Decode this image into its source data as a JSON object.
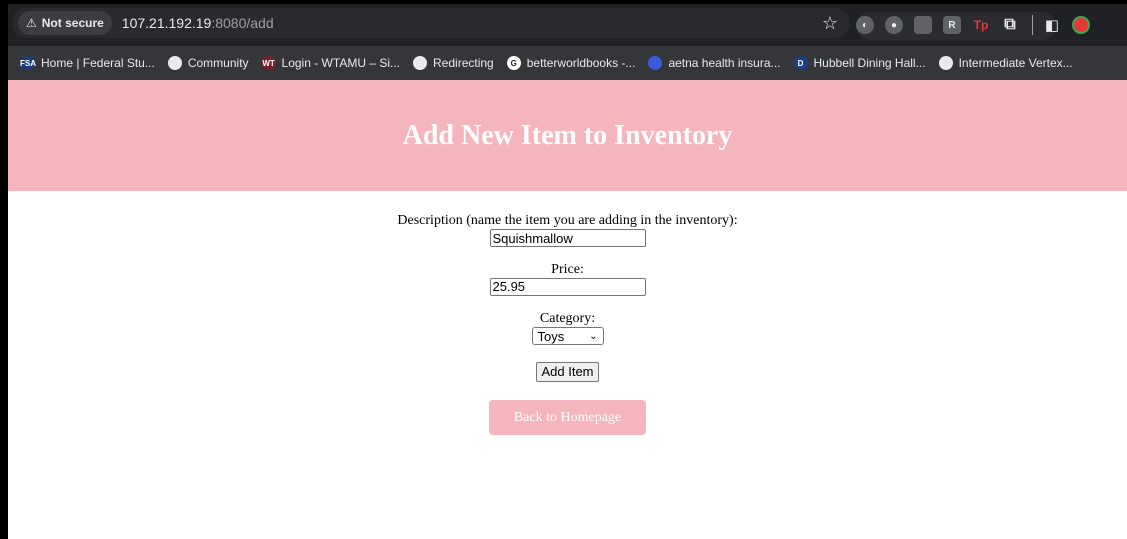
{
  "browser": {
    "security_label": "Not secure",
    "url_host": "107.21.192.19",
    "url_rest": ":8080/add",
    "bookmarks": [
      {
        "label": "Home | Federal Stu...",
        "icon": "fsa-icon",
        "badge": "FSA",
        "color": "#1a3d7c"
      },
      {
        "label": "Community",
        "icon": "globe-icon",
        "badge": "",
        "color": "#e8eaed"
      },
      {
        "label": "Login - WTAMU – Si...",
        "icon": "wt-icon",
        "badge": "WT",
        "color": "#7a1f2b"
      },
      {
        "label": "Redirecting",
        "icon": "globe-icon",
        "badge": "",
        "color": "#e8eaed"
      },
      {
        "label": "betterworldbooks -...",
        "icon": "google-icon",
        "badge": "G",
        "color": "#ffffff"
      },
      {
        "label": "aetna health insura...",
        "icon": "aetna-icon",
        "badge": "",
        "color": "#3b5bdb"
      },
      {
        "label": "Hubbell Dining Hall...",
        "icon": "d-logo-icon",
        "badge": "D",
        "color": "#1f3c88"
      },
      {
        "label": "Intermediate Vertex...",
        "icon": "globe-icon",
        "badge": "",
        "color": "#e8eaed"
      }
    ]
  },
  "page": {
    "title": "Add New Item to Inventory",
    "description_label": "Description (name the item you are adding in the inventory):",
    "description_value": "Squishmallow",
    "price_label": "Price:",
    "price_value": "25.95",
    "category_label": "Category:",
    "category_selected": "Toys",
    "submit_label": "Add Item",
    "back_label": "Back to Homepage"
  },
  "colors": {
    "header_pink": "#f5b5bd",
    "chrome_dark": "#202124",
    "bookmarks_bar": "#35363a"
  }
}
